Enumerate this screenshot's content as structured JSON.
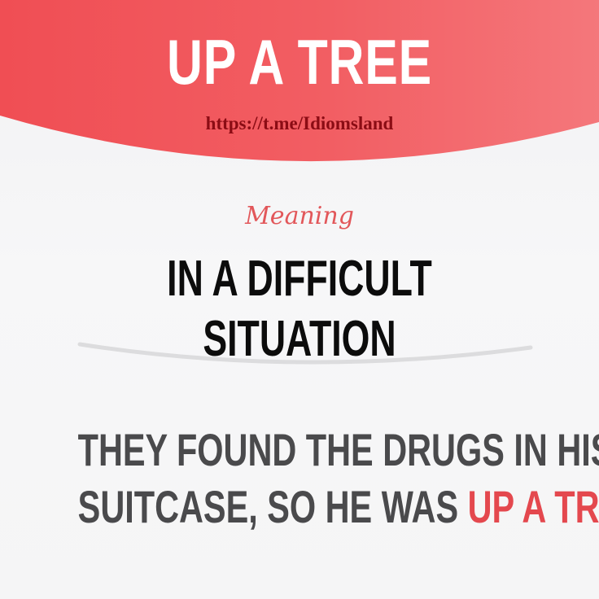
{
  "idiom": {
    "title": "UP A TREE"
  },
  "channel": {
    "link_text": "https://t.me/Idiomsland"
  },
  "meaning": {
    "label": "Meaning",
    "text": "IN A DIFFICULT SITUATION"
  },
  "example": {
    "line1": "THEY FOUND THE DRUGS IN HIS",
    "line2_prefix": "SUITCASE, SO HE WAS",
    "line2_highlight": "UP A TREE"
  },
  "colors": {
    "header_red": "#f2555a",
    "header_red_light": "#f6787c",
    "link_dark_red": "#8b0c14",
    "meaning_label": "#e2575a",
    "highlight": "#e4484e",
    "example_text": "#4a4a4c",
    "meaning_text": "#0c0c0c"
  }
}
